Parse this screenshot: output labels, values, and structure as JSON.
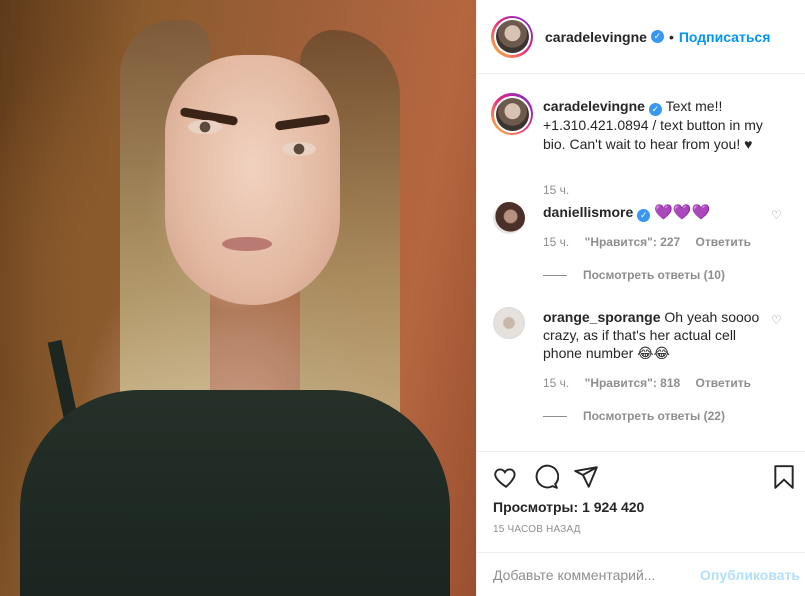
{
  "post": {
    "username": "caradelevingne",
    "follow_label": "Подписаться",
    "separator": "•",
    "caption": "Text me!! +1.310.421.0894 / text button in my bio. Can't wait to hear from you! ♥",
    "caption_time": "15 ч."
  },
  "comments": [
    {
      "username": "daniellismore",
      "text": "💜💜💜",
      "time": "15 ч.",
      "likes": "\"Нравится\": 227",
      "reply_label": "Ответить",
      "view_replies": "Посмотреть ответы (10)"
    },
    {
      "username": "orange_sporange",
      "text": "Oh yeah soooo crazy, as if that's her actual cell phone number 😂😂",
      "time": "15 ч.",
      "likes": "\"Нравится\": 818",
      "reply_label": "Ответить",
      "view_replies": "Посмотреть ответы (22)"
    }
  ],
  "actions": {
    "views_label": "Просмотры:",
    "views_count": "1 924 420",
    "posted_ago": "15 ЧАСОВ НАЗАД"
  },
  "add_comment": {
    "placeholder": "Добавьте комментарий...",
    "publish_label": "Опубликовать"
  },
  "colors": {
    "accent": "#0095f6",
    "verified": "#3897f0",
    "muted": "#8e8e8e",
    "publish_disabled": "#b2dffc"
  },
  "icons": [
    "verified-badge-icon",
    "heart-icon",
    "comment-icon",
    "share-icon",
    "bookmark-icon",
    "like-comment-heart-icon"
  ]
}
